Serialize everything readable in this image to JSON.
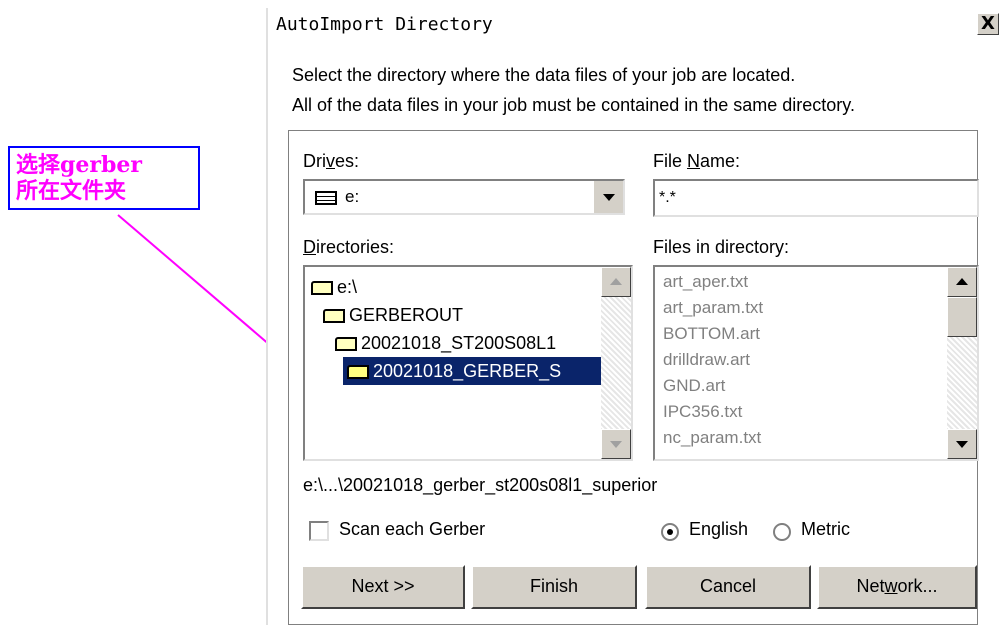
{
  "annotation": {
    "line1": "选择gerber",
    "line2": "所在文件夹",
    "color": "#ff00ff",
    "border_color": "#0000ff"
  },
  "dialog": {
    "title": "AutoImport Directory",
    "close_label": "X",
    "instructions": [
      "Select the directory where the data files of your job are located.",
      "All of the data files in your job must be contained in the same directory."
    ]
  },
  "drives": {
    "label_pre": "Dri",
    "label_u": "v",
    "label_post": "es:",
    "value": "e:"
  },
  "file_name": {
    "label_pre": "File ",
    "label_u": "N",
    "label_post": "ame:",
    "value": "*.*"
  },
  "directories": {
    "label_pre": "",
    "label_u": "D",
    "label_post": "irectories:",
    "items": [
      {
        "label": "e:\\",
        "selected": false
      },
      {
        "label": "GERBEROUT",
        "selected": false
      },
      {
        "label": "20021018_ST200S08L1",
        "selected": false
      },
      {
        "label": "20021018_GERBER_S",
        "selected": true
      }
    ]
  },
  "files": {
    "label": "Files in directory:",
    "items": [
      "art_aper.txt",
      "art_param.txt",
      "BOTTOM.art",
      "drilldraw.art",
      "GND.art",
      "IPC356.txt",
      "nc_param.txt"
    ]
  },
  "current_path": "e:\\...\\20021018_gerber_st200s08l1_superior",
  "scan_each_gerber": {
    "label": "Scan each Gerber",
    "checked": false
  },
  "units": {
    "english": {
      "label": "English",
      "checked": true
    },
    "metric": {
      "label": "Metric",
      "checked": false
    }
  },
  "buttons": {
    "next": "Next >>",
    "finish": "Finish",
    "cancel": "Cancel",
    "network_pre": "Net",
    "network_u": "w",
    "network_post": "ork..."
  },
  "colors": {
    "selection_bg": "#0a246a",
    "button_face": "#d4d0c8"
  }
}
